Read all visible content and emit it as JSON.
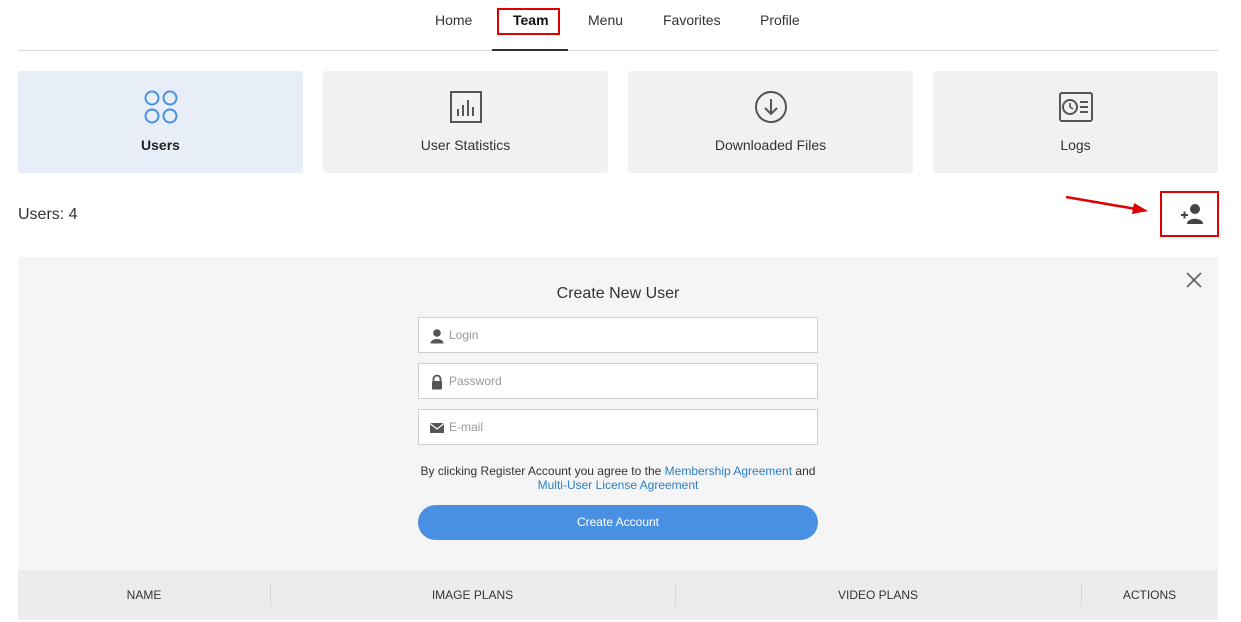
{
  "nav": {
    "items": [
      {
        "label": "Home"
      },
      {
        "label": "Team",
        "active": true
      },
      {
        "label": "Menu"
      },
      {
        "label": "Favorites"
      },
      {
        "label": "Profile"
      }
    ]
  },
  "tiles": [
    {
      "label": "Users",
      "icon": "users-grid-icon",
      "active": true
    },
    {
      "label": "User Statistics",
      "icon": "bar-chart-icon"
    },
    {
      "label": "Downloaded Files",
      "icon": "download-circle-icon"
    },
    {
      "label": "Logs",
      "icon": "clock-list-icon"
    }
  ],
  "users": {
    "count_label": "Users: 4",
    "add_icon": "add-user-icon"
  },
  "create_user": {
    "title": "Create New User",
    "login_placeholder": "Login",
    "password_placeholder": "Password",
    "email_placeholder": "E-mail",
    "agree_prefix": "By clicking Register Account you agree to the",
    "membership_link": "Membership Agreement",
    "agree_and": "and",
    "license_link": "Multi-User License Agreement",
    "submit_label": "Create Account"
  },
  "table": {
    "columns": [
      "NAME",
      "IMAGE PLANS",
      "VIDEO PLANS",
      "ACTIONS"
    ]
  },
  "colors": {
    "accent": "#4a90e2",
    "link": "#2a7ec8",
    "annotation": "#e00000",
    "active_tile": "#e7eef8"
  }
}
